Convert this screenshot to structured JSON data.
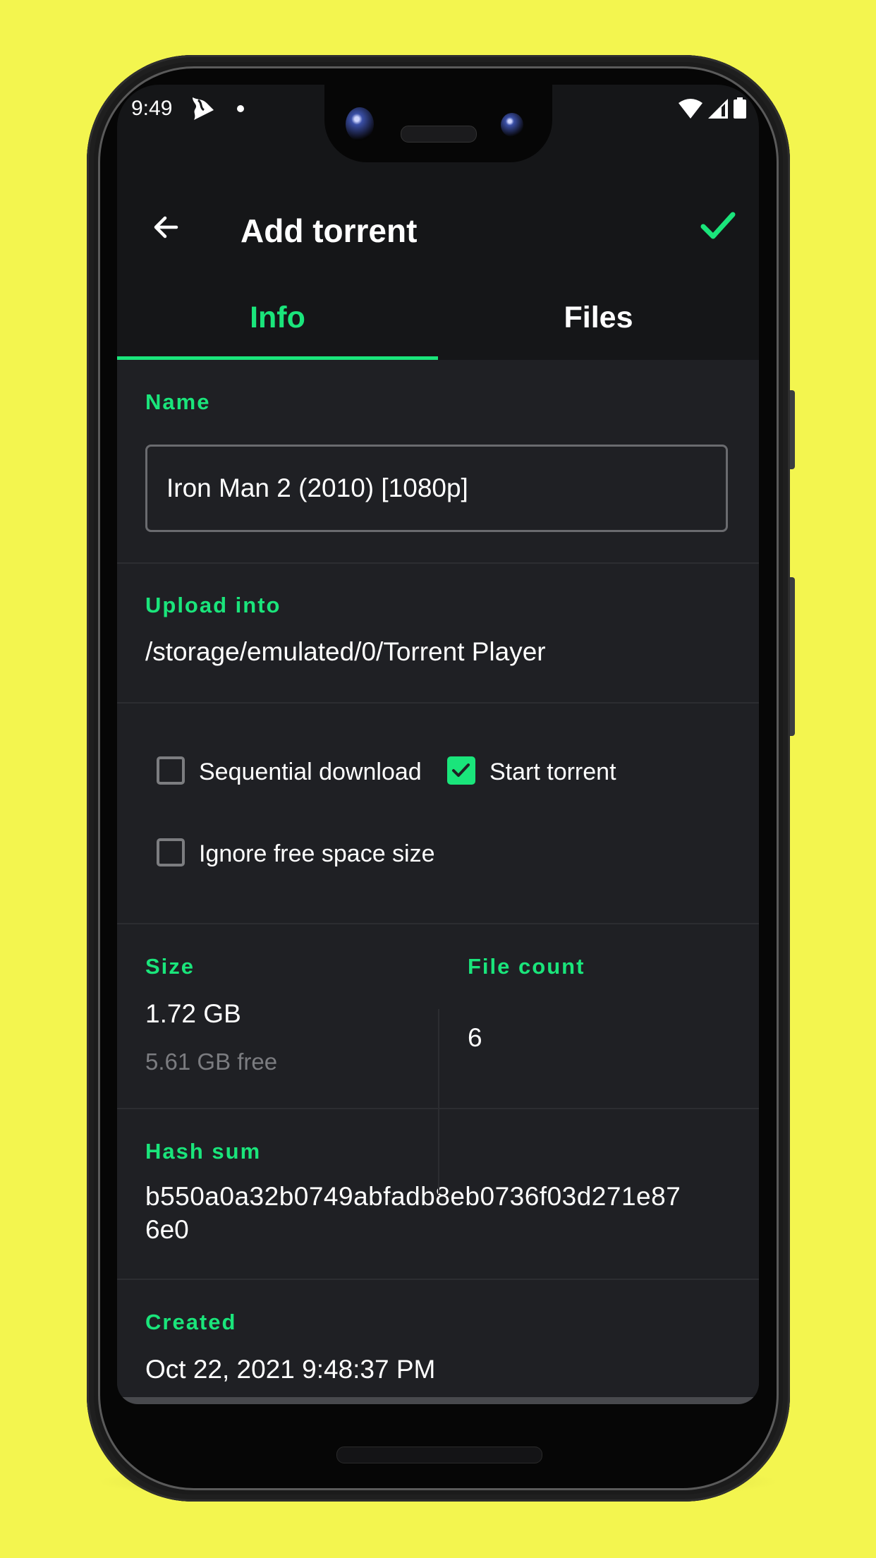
{
  "status_bar": {
    "time": "9:49",
    "app_icon": "torrent-player-icon",
    "notification_dot": "notification-dot-icon",
    "right_icons": [
      "wifi-icon",
      "cell-signal-icon",
      "battery-icon"
    ]
  },
  "toolbar": {
    "back_icon": "arrow-left-icon",
    "title": "Add torrent",
    "confirm_icon": "check-icon"
  },
  "tabs": [
    {
      "label": "Info",
      "active": true
    },
    {
      "label": "Files",
      "active": false
    }
  ],
  "form": {
    "name": {
      "label": "Name",
      "value": "Iron Man 2 (2010) [1080p]"
    },
    "upload_into": {
      "label": "Upload into",
      "value": "/storage/emulated/0/Torrent Player"
    },
    "options": [
      {
        "label": "Sequential download",
        "checked": false
      },
      {
        "label": "Start torrent",
        "checked": true
      },
      {
        "label": "Ignore free space size",
        "checked": false
      }
    ],
    "size": {
      "label": "Size",
      "value": "1.72 GB",
      "free": "5.61 GB free"
    },
    "file_count": {
      "label": "File count",
      "value": "6"
    },
    "hash_sum": {
      "label": "Hash sum",
      "line1": "b550a0a32b0749abfadb8eb0736f03d271e87",
      "line2": "6e0"
    },
    "created": {
      "label": "Created",
      "value": "Oct 22, 2021 9:48:37 PM"
    }
  },
  "colors": {
    "accent": "#1ae57b",
    "background": "#f3f54f",
    "surface": "#1f2024",
    "toolbar": "#151618"
  }
}
